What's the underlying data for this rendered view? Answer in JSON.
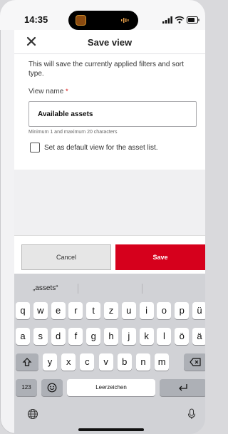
{
  "status": {
    "time": "14:35"
  },
  "header": {
    "title": "Save view",
    "close_icon": "close-icon"
  },
  "form": {
    "description": "This will save the currently applied filters and sort type.",
    "view_name_label": "View name",
    "required_mark": "*",
    "view_name_value": "Available assets",
    "hint": "Minimum 1 and maximum 20 characters",
    "default_checkbox_label": "Set as default view for the asset list.",
    "default_checked": false
  },
  "actions": {
    "cancel_label": "Cancel",
    "save_label": "Save"
  },
  "colors": {
    "accent": "#d6001c"
  },
  "keyboard": {
    "suggestion": "„assets“",
    "row1": [
      "q",
      "w",
      "e",
      "r",
      "t",
      "z",
      "u",
      "i",
      "o",
      "p",
      "ü"
    ],
    "row2": [
      "a",
      "s",
      "d",
      "f",
      "g",
      "h",
      "j",
      "k",
      "l",
      "ö",
      "ä"
    ],
    "row3": [
      "y",
      "x",
      "c",
      "v",
      "b",
      "n",
      "m"
    ],
    "numbers_label": "123",
    "space_label": "Leerzeichen"
  }
}
